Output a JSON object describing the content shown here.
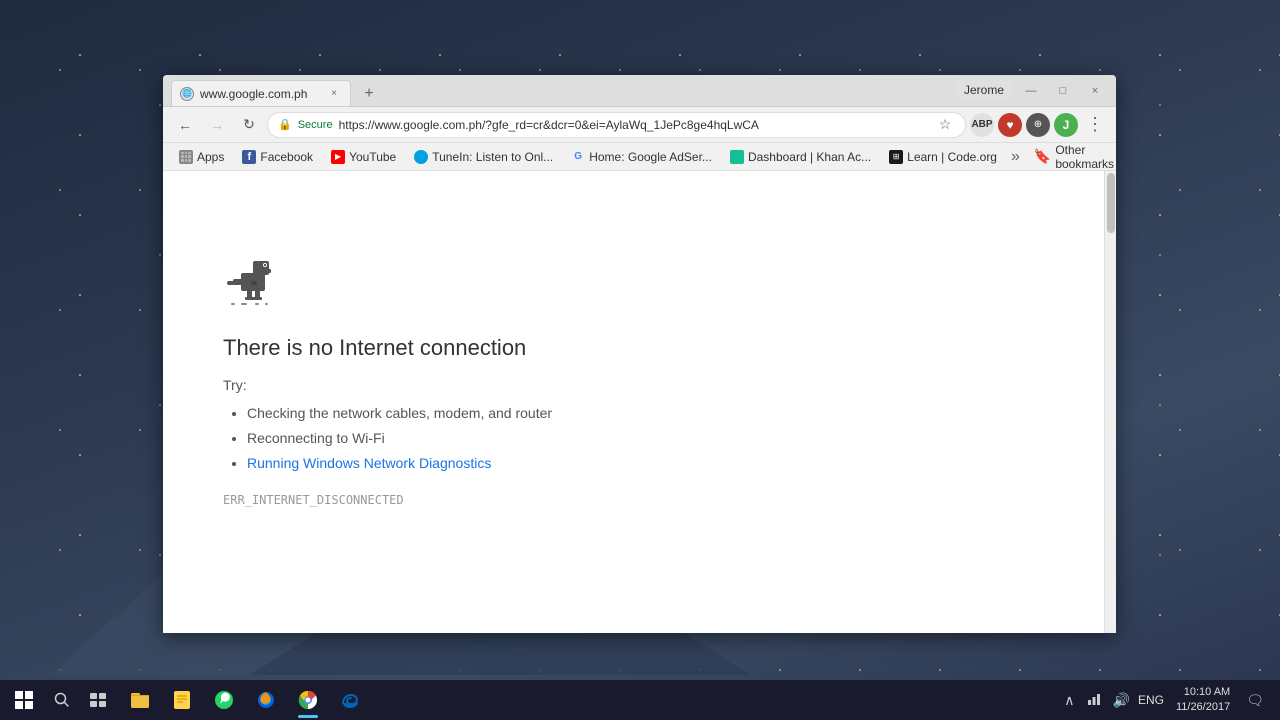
{
  "desktop": {
    "background": "#2d3a52"
  },
  "browser": {
    "tab": {
      "favicon": "globe",
      "title": "www.google.com.ph",
      "close": "×"
    },
    "window_controls": {
      "user": "Jerome",
      "minimize": "—",
      "maximize": "□",
      "close": "×"
    },
    "navigation": {
      "back": "←",
      "forward": "→",
      "reload": "↻",
      "secure_label": "Secure",
      "url": "https://www.google.com.ph/?gfe_rd=cr&dcr=0&ei=AylaWq_1JePc8ge4hqLwCA",
      "bookmark_star": "☆",
      "abp": "ABP",
      "menu": "⋮"
    },
    "bookmarks": [
      {
        "id": "apps",
        "icon": "apps",
        "label": "Apps"
      },
      {
        "id": "facebook",
        "icon": "facebook",
        "label": "Facebook"
      },
      {
        "id": "youtube",
        "icon": "youtube",
        "label": "YouTube"
      },
      {
        "id": "tunein",
        "icon": "tunein",
        "label": "TuneIn: Listen to Onl..."
      },
      {
        "id": "google-home",
        "icon": "google",
        "label": "Home: Google AdSer..."
      },
      {
        "id": "khan",
        "icon": "khan",
        "label": "Dashboard | Khan Ac..."
      },
      {
        "id": "code",
        "icon": "code",
        "label": "Learn | Code.org"
      }
    ],
    "other_bookmarks": "Other bookmarks"
  },
  "error_page": {
    "title": "There is no Internet connection",
    "try_label": "Try:",
    "suggestions": [
      "Checking the network cables, modem, and router",
      "Reconnecting to Wi-Fi",
      "Running Windows Network Diagnostics"
    ],
    "link_text": "Running Windows Network Diagnostics",
    "error_code": "ERR_INTERNET_DISCONNECTED"
  },
  "taskbar": {
    "start_label": "Start",
    "search_label": "Search",
    "time": "10:10 AM",
    "date": "11/26/2017",
    "lang": "ENG",
    "apps": [
      {
        "id": "file-explorer",
        "label": "File Explorer"
      },
      {
        "id": "notes",
        "label": "Notes"
      },
      {
        "id": "whatsapp",
        "label": "WhatsApp"
      },
      {
        "id": "firefox",
        "label": "Firefox"
      },
      {
        "id": "chrome",
        "label": "Google Chrome"
      },
      {
        "id": "edge",
        "label": "Microsoft Edge"
      }
    ]
  }
}
